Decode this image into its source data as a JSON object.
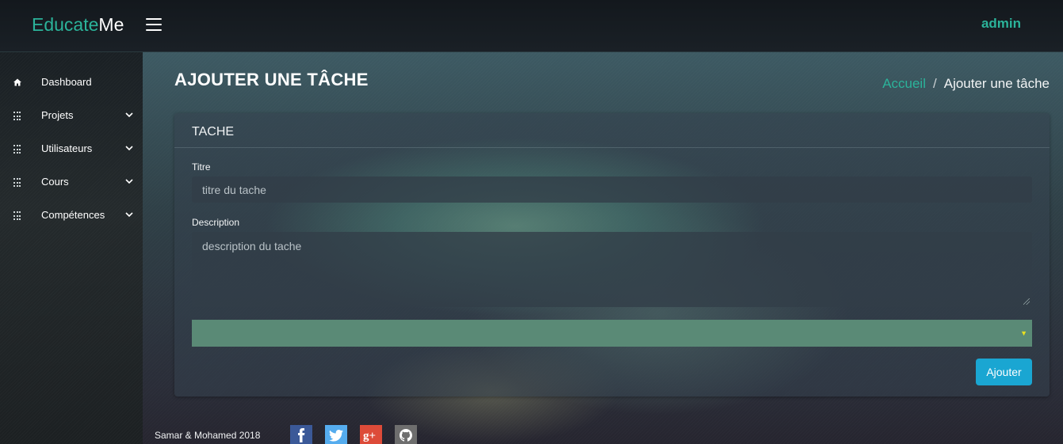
{
  "app": {
    "brand_part1": "Educate",
    "brand_part2": "Me",
    "user": "admin"
  },
  "sidebar": {
    "items": [
      {
        "label": "Dashboard",
        "icon": "home-icon"
      },
      {
        "label": "Projets",
        "icon": "grid-icon",
        "expandable": true
      },
      {
        "label": "Utilisateurs",
        "icon": "grid-icon",
        "expandable": true
      },
      {
        "label": "Cours",
        "icon": "grid-icon",
        "expandable": true
      },
      {
        "label": "Compétences",
        "icon": "grid-icon",
        "expandable": true
      }
    ]
  },
  "page": {
    "title": "AJOUTER UNE TÂCHE"
  },
  "breadcrumb": {
    "home": "Accueil",
    "separator": "/",
    "current": "Ajouter une tâche"
  },
  "form": {
    "card_title": "TACHE",
    "title_label": "Titre",
    "title_placeholder": "titre du tache",
    "title_value": "",
    "description_label": "Description",
    "description_placeholder": "description du tache",
    "description_value": "",
    "select_value": "",
    "submit_label": "Ajouter"
  },
  "footer": {
    "text": "Samar & Mohamed 2018",
    "social": [
      {
        "name": "facebook-icon",
        "color": "#3b5998"
      },
      {
        "name": "twitter-icon",
        "color": "#55acee"
      },
      {
        "name": "google-plus-icon",
        "color": "#dd4b39"
      },
      {
        "name": "github-icon",
        "color": "#6e6e6e"
      }
    ]
  },
  "colors": {
    "accent": "#2bb39a",
    "button": "#1aa6d2",
    "select_bg": "#5a8a76"
  }
}
